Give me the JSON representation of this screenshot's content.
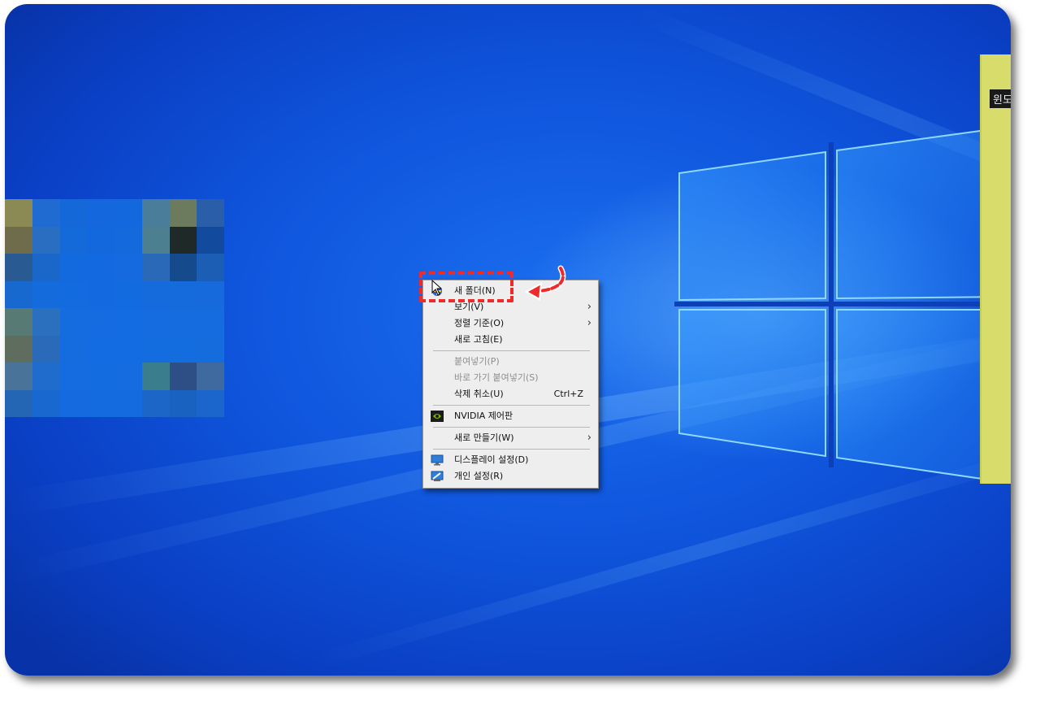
{
  "desktop": {
    "side_note_label": "윈도"
  },
  "context_menu": {
    "items": [
      {
        "label": "새 폴더(N)",
        "icon": "new-folder-shield-icon",
        "disabled": false
      },
      {
        "label": "보기(V)",
        "submenu": true,
        "disabled": false
      },
      {
        "label": "정렬 기준(O)",
        "submenu": true,
        "disabled": false
      },
      {
        "label": "새로 고침(E)",
        "disabled": false
      },
      {
        "label": "붙여넣기(P)",
        "disabled": true
      },
      {
        "label": "바로 가기 붙여넣기(S)",
        "disabled": true
      },
      {
        "label": "삭제 취소(U)",
        "shortcut": "Ctrl+Z",
        "disabled": false
      },
      {
        "label": "NVIDIA 제어판",
        "icon": "nvidia-icon",
        "disabled": false
      },
      {
        "label": "새로 만들기(W)",
        "submenu": true,
        "disabled": false
      },
      {
        "label": "디스플레이 설정(D)",
        "icon": "display-icon",
        "disabled": false
      },
      {
        "label": "개인 설정(R)",
        "icon": "personalize-icon",
        "disabled": false
      }
    ],
    "arrow_glyph": "›"
  },
  "colors": {
    "annotation": "#ee2a2a",
    "menu_bg": "#eeeeee",
    "desktop_blue": "#0f56dd"
  }
}
